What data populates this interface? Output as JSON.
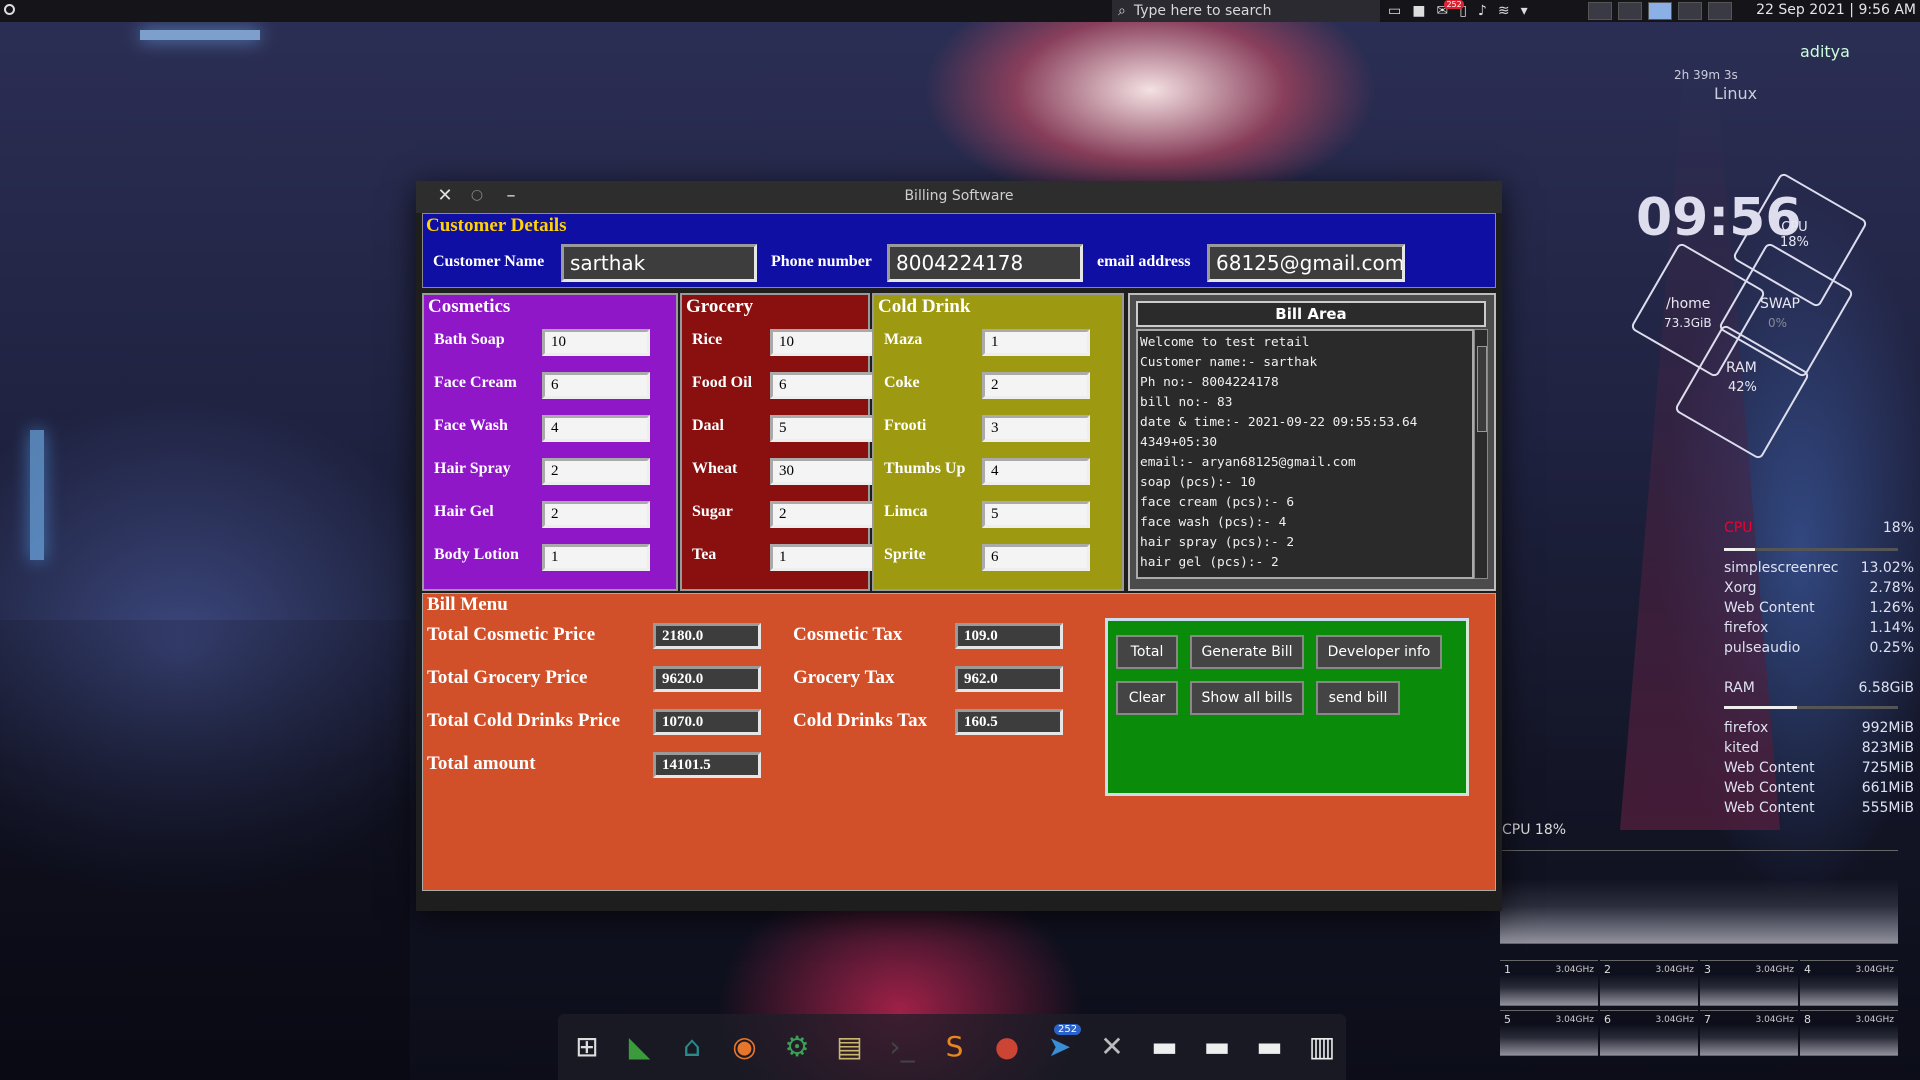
{
  "topbar": {
    "search_placeholder": "Type here to search",
    "datetime": "22 Sep 2021 | 9:56 AM",
    "notification_count": "252"
  },
  "conky": {
    "uptime": "2h 39m 3s",
    "os": "Linux",
    "user": "aditya",
    "time": "09:56",
    "cpu_hex": "CPU\n18%",
    "home_label": "/home",
    "home_size": "73.3GiB",
    "swap_label": "SWAP",
    "swap_value": "0%",
    "ram_label": "RAM",
    "ram_value": "42%",
    "cpu_label": "CPU",
    "cpu_pct": "18%",
    "cpu_fill": 0.18,
    "cpu_procs": [
      {
        "name": "simplescreenrec",
        "value": "13.02%"
      },
      {
        "name": "Xorg",
        "value": "2.78%"
      },
      {
        "name": "Web Content",
        "value": "1.26%"
      },
      {
        "name": "firefox",
        "value": "1.14%"
      },
      {
        "name": "pulseaudio",
        "value": "0.25%"
      }
    ],
    "ram_label2": "RAM",
    "ram_amount": "6.58GiB",
    "ram_fill": 0.42,
    "ram_procs": [
      {
        "name": "firefox",
        "value": "992MiB"
      },
      {
        "name": "kited",
        "value": "823MiB"
      },
      {
        "name": "Web Content",
        "value": "725MiB"
      },
      {
        "name": "Web Content",
        "value": "661MiB"
      },
      {
        "name": "Web Content",
        "value": "555MiB"
      }
    ],
    "cpu_graph_label": "CPU 18%",
    "cores": [
      {
        "n": "1",
        "f": "3.04GHz"
      },
      {
        "n": "2",
        "f": "3.04GHz"
      },
      {
        "n": "3",
        "f": "3.04GHz"
      },
      {
        "n": "4",
        "f": "3.04GHz"
      },
      {
        "n": "5",
        "f": "3.04GHz"
      },
      {
        "n": "6",
        "f": "3.04GHz"
      },
      {
        "n": "7",
        "f": "3.04GHz"
      },
      {
        "n": "8",
        "f": "3.04GHz"
      }
    ]
  },
  "window": {
    "title": "Billing Software",
    "close": "✕",
    "maximize": "○",
    "minimize": "–"
  },
  "customer": {
    "legend": "Customer Details",
    "name_label": "Customer Name",
    "name_value": "sarthak",
    "phone_label": "Phone number",
    "phone_value": "8004224178",
    "email_label": "email address",
    "email_value": "68125@gmail.com"
  },
  "cosmetics": {
    "legend": "Cosmetics",
    "items": [
      {
        "label": "Bath Soap",
        "qty": "10"
      },
      {
        "label": "Face Cream",
        "qty": "6"
      },
      {
        "label": "Face Wash",
        "qty": "4"
      },
      {
        "label": "Hair Spray",
        "qty": "2"
      },
      {
        "label": "Hair Gel",
        "qty": "2"
      },
      {
        "label": "Body Lotion",
        "qty": "1"
      }
    ]
  },
  "grocery": {
    "legend": "Grocery",
    "items": [
      {
        "label": "Rice",
        "qty": "10"
      },
      {
        "label": "Food Oil",
        "qty": "6"
      },
      {
        "label": "Daal",
        "qty": "5"
      },
      {
        "label": "Wheat",
        "qty": "30"
      },
      {
        "label": "Sugar",
        "qty": "2"
      },
      {
        "label": "Tea",
        "qty": "1"
      }
    ]
  },
  "colddrink": {
    "legend": "Cold Drink",
    "items": [
      {
        "label": "Maza",
        "qty": "1"
      },
      {
        "label": "Coke",
        "qty": "2"
      },
      {
        "label": "Frooti",
        "qty": "3"
      },
      {
        "label": "Thumbs Up",
        "qty": "4"
      },
      {
        "label": "Limca",
        "qty": "5"
      },
      {
        "label": "Sprite",
        "qty": "6"
      }
    ]
  },
  "bill_area": {
    "title": "Bill Area",
    "lines": [
      "Welcome to test retail",
      "Customer name:- sarthak",
      "Ph no:- 8004224178",
      "bill no:- 83",
      "date & time:- 2021-09-22 09:55:53.64",
      "4349+05:30",
      "email:- aryan68125@gmail.com",
      "soap (pcs):- 10",
      "face cream (pcs):- 6",
      "face wash (pcs):- 4",
      "hair spray (pcs):- 2",
      "hair gel (pcs):- 2"
    ]
  },
  "bill_menu": {
    "legend": "Bill Menu",
    "total_cosmetic_label": "Total Cosmetic Price",
    "total_cosmetic_value": "2180.0",
    "total_grocery_label": "Total Grocery Price",
    "total_grocery_value": "9620.0",
    "total_cold_label": "Total Cold Drinks Price",
    "total_cold_value": "1070.0",
    "total_amount_label": "Total amount",
    "total_amount_value": "14101.5",
    "cosmetic_tax_label": "Cosmetic Tax",
    "cosmetic_tax_value": "109.0",
    "grocery_tax_label": "Grocery Tax",
    "grocery_tax_value": "962.0",
    "cold_tax_label": "Cold Drinks Tax",
    "cold_tax_value": "160.5",
    "buttons": {
      "total": "Total",
      "generate": "Generate Bill",
      "developer": "Developer info",
      "clear": "Clear",
      "show_all": "Show all bills",
      "send": "send bill"
    }
  },
  "dock": {
    "icons": [
      "app-grid-icon",
      "system-monitor-icon",
      "store-icon",
      "firefox-icon",
      "settings-icon",
      "files-icon",
      "terminal-icon",
      "sublime-icon",
      "recorder-icon",
      "telegram-icon",
      "x-icon",
      "folder-icon",
      "folder-icon",
      "folder-icon",
      "trash-icon"
    ]
  }
}
